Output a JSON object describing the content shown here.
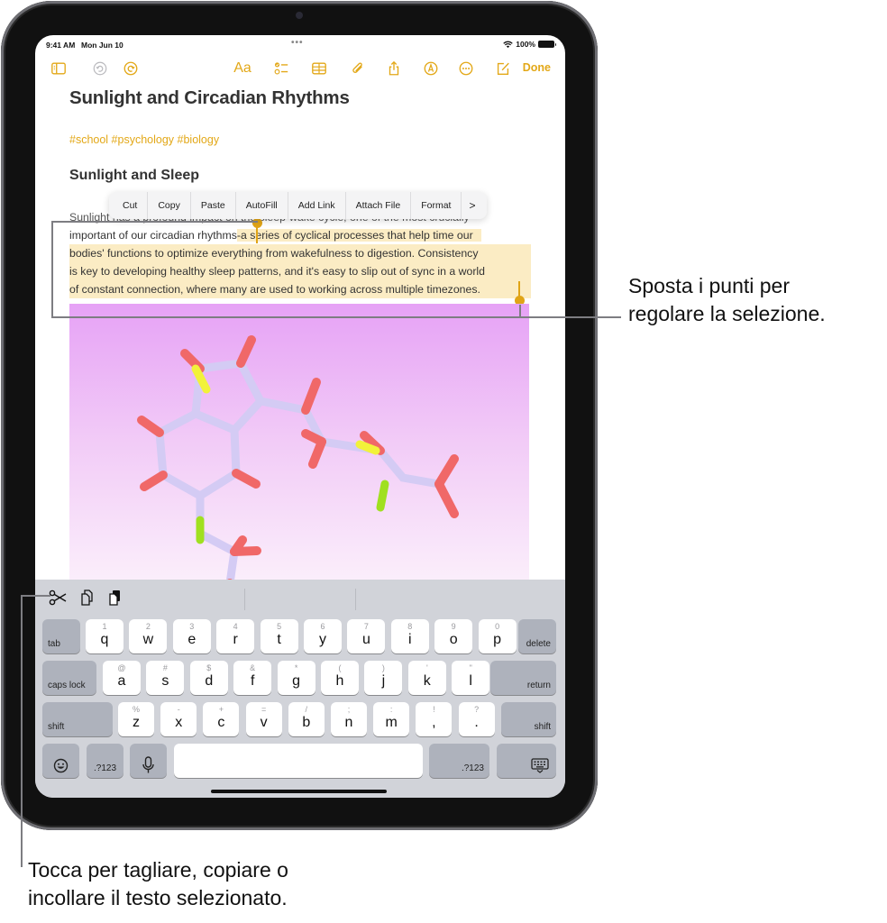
{
  "status_bar": {
    "time": "9:41 AM",
    "date": "Mon Jun 10",
    "battery": "100%"
  },
  "toolbar": {
    "icons": [
      "sidebar-icon",
      "undo-icon",
      "redo-icon",
      "text-format-icon",
      "checklist-icon",
      "table-icon",
      "attachment-icon",
      "share-icon",
      "markup-icon",
      "more-icon",
      "compose-icon"
    ],
    "format_label": "Aa",
    "done_label": "Done",
    "accent_color": "#e3a818"
  },
  "note": {
    "title": "Sunlight and Circadian Rhythms",
    "tags": "#school #psychology #biology",
    "subheading": "Sunlight and Sleep",
    "lines": [
      {
        "unselected": "Sunlight has a profound impact on the sleep-wake cycle, one of the most crucially",
        "selected": ""
      },
      {
        "unselected": "important of our circadian rhythms",
        "selected": "-a series of cyclical processes that help time our"
      },
      {
        "unselected": "",
        "selected": "bodies' functions to optimize everything from wakefulness to digestion. Consistency"
      },
      {
        "unselected": "",
        "selected": "is key to developing healthy sleep patterns, and it's easy to slip out of sync in a world"
      },
      {
        "unselected": "",
        "selected": "of constant connection, where many are used to working across multiple timezones."
      }
    ],
    "selection_color": "#fbecc4",
    "handle_color": "#e0a417",
    "image_description": "3D molecular ball-and-stick model on pink-purple gradient"
  },
  "edit_menu": {
    "items": [
      "Cut",
      "Copy",
      "Paste",
      "AutoFill",
      "Add Link",
      "Attach File",
      "Format",
      ">"
    ]
  },
  "shortcut_bar": {
    "icons": [
      "scissors-icon",
      "copy-icon",
      "paste-icon"
    ]
  },
  "keyboard": {
    "row1": {
      "left": "tab",
      "keys": [
        {
          "main": "q",
          "sec": "1"
        },
        {
          "main": "w",
          "sec": "2"
        },
        {
          "main": "e",
          "sec": "3"
        },
        {
          "main": "r",
          "sec": "4"
        },
        {
          "main": "t",
          "sec": "5"
        },
        {
          "main": "y",
          "sec": "6"
        },
        {
          "main": "u",
          "sec": "7"
        },
        {
          "main": "i",
          "sec": "8"
        },
        {
          "main": "o",
          "sec": "9"
        },
        {
          "main": "p",
          "sec": "0"
        }
      ],
      "right": "delete"
    },
    "row2": {
      "left": "caps lock",
      "keys": [
        {
          "main": "a",
          "sec": "@"
        },
        {
          "main": "s",
          "sec": "#"
        },
        {
          "main": "d",
          "sec": "$"
        },
        {
          "main": "f",
          "sec": "&"
        },
        {
          "main": "g",
          "sec": "*"
        },
        {
          "main": "h",
          "sec": "("
        },
        {
          "main": "j",
          "sec": ")"
        },
        {
          "main": "k",
          "sec": "'"
        },
        {
          "main": "l",
          "sec": "\""
        }
      ],
      "right": "return"
    },
    "row3": {
      "left": "shift",
      "keys": [
        {
          "main": "z",
          "sec": "%"
        },
        {
          "main": "x",
          "sec": "-"
        },
        {
          "main": "c",
          "sec": "+"
        },
        {
          "main": "v",
          "sec": "="
        },
        {
          "main": "b",
          "sec": "/"
        },
        {
          "main": "n",
          "sec": ";"
        },
        {
          "main": "m",
          "sec": ":"
        },
        {
          "main": ",",
          "sec": "!"
        },
        {
          "main": ".",
          "sec": "?"
        }
      ],
      "right": "shift"
    },
    "row4": {
      "emoji": "emoji-icon",
      "numbers_left": ".?123",
      "mic": "microphone-icon",
      "space": "",
      "numbers_right": ".?123",
      "dismiss": "keyboard-dismiss-icon"
    }
  },
  "callouts": {
    "handles": "Sposta i punti per\nregolare la selezione.",
    "handles_lines": [
      "Sposta i punti per",
      "regolare la selezione."
    ],
    "shortcuts_lines": [
      "Tocca per tagliare, copiare o",
      "incollare il testo selezionato."
    ]
  }
}
